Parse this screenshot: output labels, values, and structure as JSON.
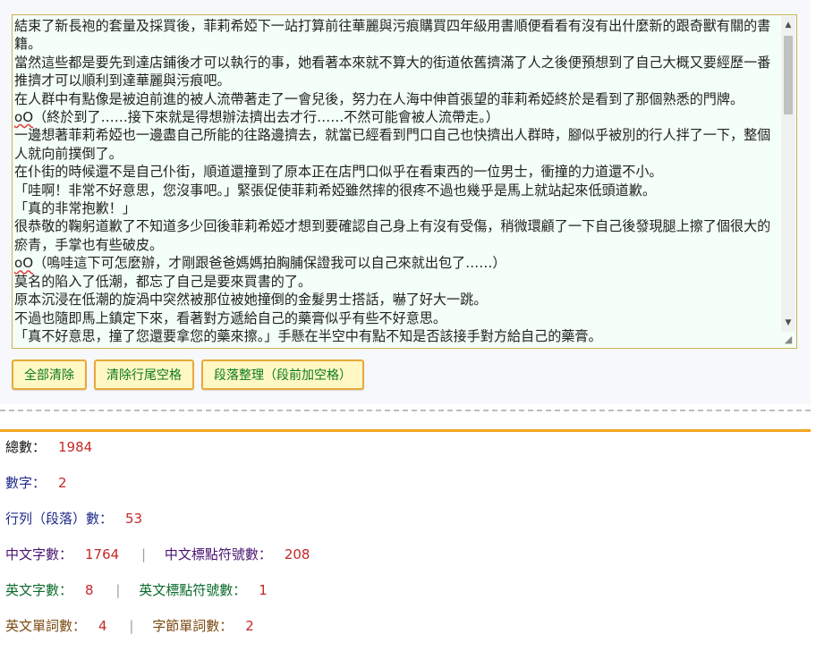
{
  "editor": {
    "lines": [
      "結束了新長袍的套量及採買後，菲莉希婭下一站打算前往華麗與污痕購買四年級用書順便看看有沒有出什麼新的跟奇獸有關的書籍。",
      "當然這些都是要先到達店鋪後才可以執行的事，她看著本來就不算大的街道依舊擠滿了人之後便預想到了自己大概又要經歷一番推擠才可以順利到達華麗與污痕吧。",
      "在人群中有點像是被迫前進的被人流帶著走了一會兒後，努力在人海中伸首張望的菲莉希婭終於是看到了那個熟悉的門牌。",
      "oO（終於到了……接下來就是得想辦法擠出去才行……不然可能會被人流帶走。）",
      "一邊想著菲莉希婭也一邊盡自己所能的往路邊擠去，就當已經看到門口自己也快擠出人群時，腳似乎被別的行人拌了一下，整個人就向前撲倒了。",
      "在仆街的時候還不是自己仆街，順道還撞到了原本正在店門口似乎在看東西的一位男士，衝撞的力道還不小。",
      "「哇啊！非常不好意思，您沒事吧。」緊張促使菲莉希婭雖然摔的很疼不過也幾乎是馬上就站起來低頭道歉。",
      "「真的非常抱歉！」",
      "很恭敬的鞠躬道歉了不知道多少回後菲莉希婭才想到要確認自己身上有沒有受傷，稍微環顧了一下自己後發現腿上擦了個很大的瘀青，手掌也有些破皮。",
      "oO（嗚哇這下可怎麼辦，才剛跟爸爸媽媽拍胸脯保證我可以自己來就出包了……）",
      "莫名的陷入了低潮，都忘了自己是要來買書的了。",
      "原本沉浸在低潮的旋渦中突然被那位被她撞倒的金髮男士搭話，嚇了好大一跳。",
      "不過也隨即馬上鎮定下來，看著對方遞給自己的藥膏似乎有些不好意思。",
      "「真不好意思，撞了您還要拿您的藥來擦。」手懸在半空中有點不知是否該接手對方給自己的藥膏。"
    ]
  },
  "buttons": {
    "clear_all": "全部清除",
    "trim_trailing": "清除行尾空格",
    "paragraph_format": "段落整理（段前加空格）"
  },
  "stats": {
    "total_label": "總數：",
    "total_value": "1984",
    "digits_label": "數字：",
    "digits_value": "2",
    "lines_label": "行列（段落）數：",
    "lines_value": "53",
    "cn_chars_label": "中文字數：",
    "cn_chars_value": "1764",
    "cn_punct_label": "中文標點符號數：",
    "cn_punct_value": "208",
    "en_chars_label": "英文字數：",
    "en_chars_value": "8",
    "en_punct_label": "英文標點符號數：",
    "en_punct_value": "1",
    "en_words_label": "英文單詞數：",
    "en_words_value": "4",
    "byte_words_label": "字節單詞數：",
    "byte_words_value": "2",
    "separator": "|"
  },
  "colors": {
    "button_border": "#e8a93a",
    "button_bg": "#fff8c4",
    "button_text": "#0a7a1f",
    "value_text": "#c62828",
    "divider": "#f2a41f",
    "editor_bg": "#f3fff7"
  }
}
